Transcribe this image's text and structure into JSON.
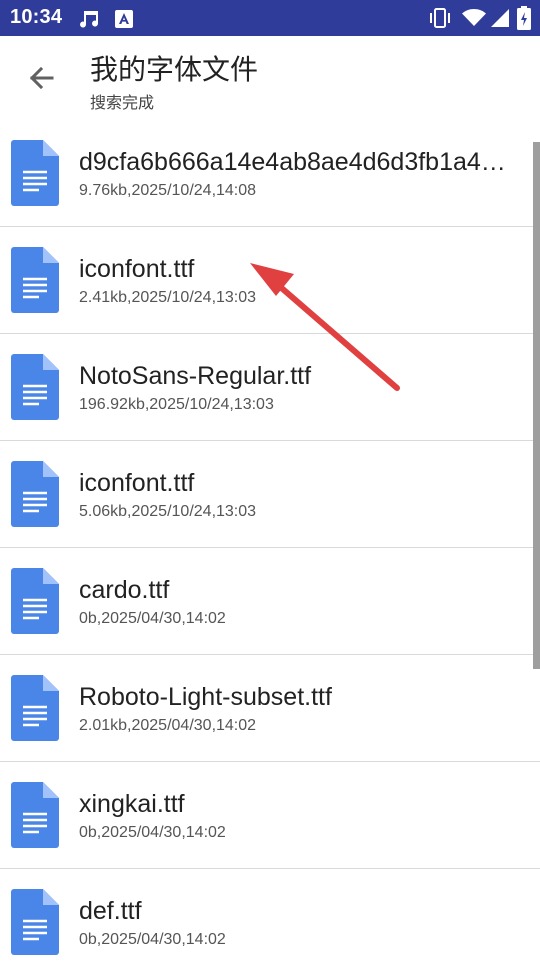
{
  "status": {
    "time": "10:34"
  },
  "toolbar": {
    "title": "我的字体文件",
    "subtitle": "搜索完成"
  },
  "files": [
    {
      "name": "d9cfa6b666a14e4ab8ae4d6d3fb1a4…",
      "meta": "9.76kb,2025/10/24,14:08"
    },
    {
      "name": "iconfont.ttf",
      "meta": "2.41kb,2025/10/24,13:03"
    },
    {
      "name": "NotoSans-Regular.ttf",
      "meta": "196.92kb,2025/10/24,13:03"
    },
    {
      "name": "iconfont.ttf",
      "meta": "5.06kb,2025/10/24,13:03"
    },
    {
      "name": "cardo.ttf",
      "meta": "0b,2025/04/30,14:02"
    },
    {
      "name": "Roboto-Light-subset.ttf",
      "meta": "2.01kb,2025/04/30,14:02"
    },
    {
      "name": "xingkai.ttf",
      "meta": "0b,2025/04/30,14:02"
    },
    {
      "name": "def.ttf",
      "meta": "0b,2025/04/30,14:02"
    }
  ],
  "icons": {
    "back": "arrow-left-icon",
    "file": "document-icon",
    "music": "music-note-icon",
    "text": "text-a-icon",
    "vibrate": "vibrate-icon",
    "wifi": "wifi-icon",
    "signal": "signal-icon",
    "battery": "battery-icon"
  },
  "colors": {
    "status_bar": "#2f3c99",
    "file_icon": "#4a86e8",
    "annotation_arrow": "#e04040"
  }
}
